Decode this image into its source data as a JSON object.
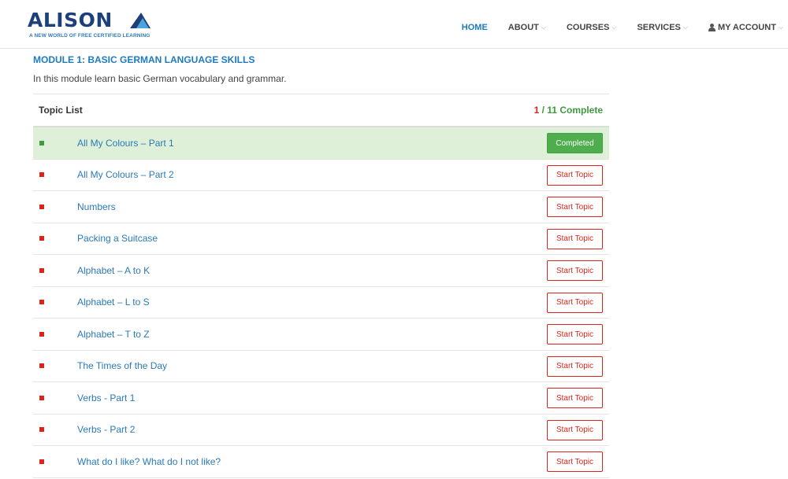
{
  "brand": {
    "name": "ALISON",
    "tagline": "A NEW WORLD OF FREE CERTIFIED LEARNING"
  },
  "nav": {
    "home": "HOME",
    "about": "ABOUT",
    "courses": "COURSES",
    "services": "SERVICES",
    "account": "MY ACCOUNT"
  },
  "module": {
    "title": "MODULE 1: BASIC GERMAN LANGUAGE SKILLS",
    "description": "In this module learn basic German vocabulary and grammar."
  },
  "topic_list": {
    "heading": "Topic List",
    "completed_count": "1",
    "total_label": " / 11 Complete",
    "completed_button": "Completed",
    "start_button": "Start Topic",
    "topics": [
      {
        "title": "All My Colours – Part 1",
        "status": "completed"
      },
      {
        "title": "All My Colours – Part 2",
        "status": "start"
      },
      {
        "title": "Numbers",
        "status": "start"
      },
      {
        "title": "Packing a Suitcase",
        "status": "start"
      },
      {
        "title": "Alphabet – A to K",
        "status": "start"
      },
      {
        "title": "Alphabet – L to S",
        "status": "start"
      },
      {
        "title": "Alphabet – T to Z",
        "status": "start"
      },
      {
        "title": "The Times of the Day",
        "status": "start"
      },
      {
        "title": "Verbs - Part 1",
        "status": "start"
      },
      {
        "title": "Verbs - Part 2",
        "status": "start"
      },
      {
        "title": "What do I like? What do I not like?",
        "status": "start"
      }
    ]
  },
  "colors": {
    "accent_blue": "#1e7bc0",
    "complete_green": "#4eae4e",
    "pending_red": "#d9261c",
    "completed_row_bg": "#dff0d8"
  }
}
